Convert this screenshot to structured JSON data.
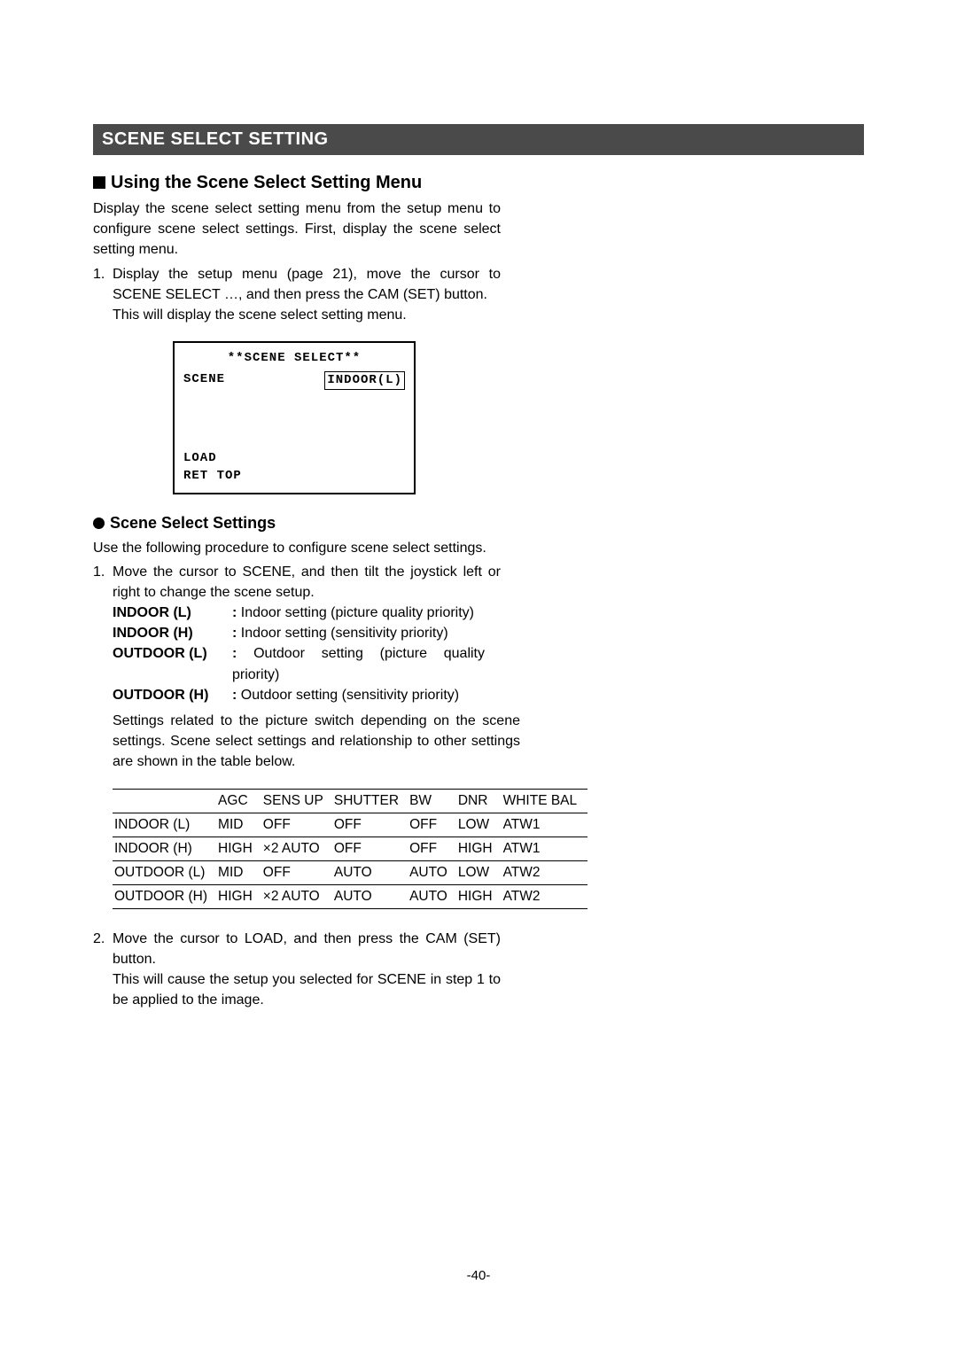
{
  "header": "SCENE SELECT SETTING",
  "section1": {
    "title": "Using the Scene Select Setting Menu",
    "intro": "Display the scene select setting menu from the setup menu to configure scene select settings. First, display the scene select setting menu.",
    "step1_num": "1.",
    "step1_a": "Display the setup menu (page 21), move the cursor to SCENE SELECT …, and then press the CAM (SET) button.",
    "step1_b": "This will display the scene select setting menu."
  },
  "osd": {
    "title": "**SCENE SELECT**",
    "scene_label": "SCENE",
    "scene_value": "INDOOR(L)",
    "load": "LOAD",
    "ret_top": "RET TOP"
  },
  "section2": {
    "title": "Scene Select Settings",
    "intro": "Use the following procedure to configure scene select settings.",
    "step1_num": "1.",
    "step1_text": "Move the cursor to SCENE, and then tilt the joystick left or right to change the scene setup.",
    "defs": [
      {
        "term": "INDOOR (L)",
        "body": "Indoor setting (picture quality priority)"
      },
      {
        "term": "INDOOR (H)",
        "body": "Indoor setting (sensitivity priority)"
      },
      {
        "term": "OUTDOOR (L)",
        "body": "Outdoor setting (picture quality priority)"
      },
      {
        "term": "OUTDOOR (H)",
        "body": "Outdoor setting (sensitivity priority)"
      }
    ],
    "closing": "Settings related to the picture switch depending on the scene settings. Scene select settings and relationship to other settings are shown in the table below."
  },
  "table": {
    "headers": [
      "",
      "AGC",
      "SENS UP",
      "SHUTTER",
      "BW",
      "DNR",
      "WHITE BAL"
    ],
    "rows": [
      [
        "INDOOR (L)",
        "MID",
        "OFF",
        "OFF",
        "OFF",
        "LOW",
        "ATW1"
      ],
      [
        "INDOOR (H)",
        "HIGH",
        "×2 AUTO",
        "OFF",
        "OFF",
        "HIGH",
        "ATW1"
      ],
      [
        "OUTDOOR (L)",
        "MID",
        "OFF",
        "AUTO",
        "AUTO",
        "LOW",
        "ATW2"
      ],
      [
        "OUTDOOR (H)",
        "HIGH",
        "×2 AUTO",
        "AUTO",
        "AUTO",
        "HIGH",
        "ATW2"
      ]
    ]
  },
  "step2": {
    "num": "2.",
    "a": "Move the cursor to LOAD, and then press the CAM (SET) button.",
    "b": "This will cause the setup you selected for SCENE in step 1 to be applied to the image."
  },
  "page_number": "-40-"
}
